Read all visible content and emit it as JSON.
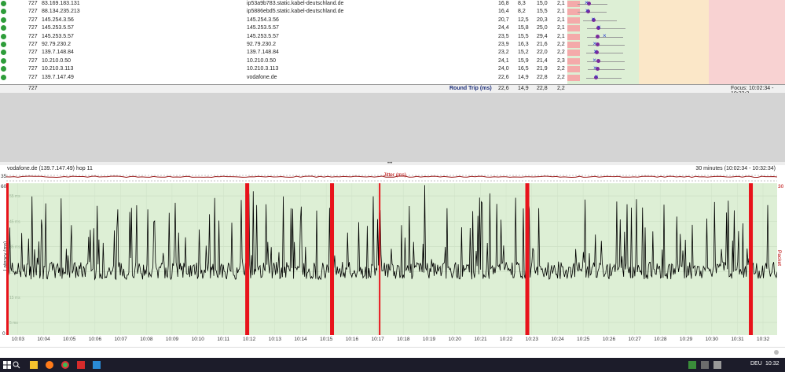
{
  "hops": [
    {
      "count": "727",
      "ip": "83.169.183.131",
      "name": "ip53a9b783.static.kabel-deutschland.de",
      "avg": "16,8",
      "min": "8,3",
      "cur": "15,0",
      "pl": "2,1"
    },
    {
      "count": "727",
      "ip": "88.134.235.213",
      "name": "ip5886ebd5.static.kabel-deutschland.de",
      "avg": "16,4",
      "min": "8,2",
      "cur": "15,5",
      "pl": "2,1"
    },
    {
      "count": "727",
      "ip": "145.254.3.56",
      "name": "145.254.3.56",
      "avg": "20,7",
      "min": "12,5",
      "cur": "20,3",
      "pl": "2,1"
    },
    {
      "count": "727",
      "ip": "145.253.5.57",
      "name": "145.253.5.57",
      "avg": "24,4",
      "min": "15,8",
      "cur": "25,0",
      "pl": "2,1"
    },
    {
      "count": "727",
      "ip": "145.253.5.57",
      "name": "145.253.5.57",
      "avg": "23,5",
      "min": "15,5",
      "cur": "29,4",
      "pl": "2,1"
    },
    {
      "count": "727",
      "ip": "92.79.230.2",
      "name": "92.79.230.2",
      "avg": "23,9",
      "min": "16,3",
      "cur": "21,6",
      "pl": "2,2"
    },
    {
      "count": "727",
      "ip": "139.7.148.84",
      "name": "139.7.148.84",
      "avg": "23,2",
      "min": "15,2",
      "cur": "22,0",
      "pl": "2,2"
    },
    {
      "count": "727",
      "ip": "10.210.0.50",
      "name": "10.210.0.50",
      "avg": "24,1",
      "min": "15,9",
      "cur": "21,4",
      "pl": "2,3"
    },
    {
      "count": "727",
      "ip": "10.210.3.113",
      "name": "10.210.3.113",
      "avg": "24,0",
      "min": "16,5",
      "cur": "21,9",
      "pl": "2,2"
    },
    {
      "count": "727",
      "ip": "139.7.147.49",
      "name": "vodafone.de",
      "avg": "22,6",
      "min": "14,9",
      "cur": "22,8",
      "pl": "2,2"
    }
  ],
  "footer": {
    "count": "727",
    "label": "Round Trip (ms)",
    "avg": "22,6",
    "min": "14,9",
    "cur": "22,8",
    "pl": "2,2",
    "focus": "Focus: 10:02:34 - 10:32:3"
  },
  "graph": {
    "title": "vodafone.de (139.7.147.49) hop 11",
    "range": "30 minutes (10:02:34 - 10:32:34)",
    "jitter_label": "Jitter (ms)",
    "y_left_title": "Latency (ms)",
    "y_right_title": "Packet Loss %",
    "y_left_top": "60",
    "y_left_jitter": "35",
    "y_left_zero": "0",
    "y_right_top": "30",
    "ms_ticks": [
      "55 ms",
      "45 ms",
      "35 ms",
      "25 ms",
      "15 ms",
      "5 ms"
    ],
    "x_ticks": [
      "10:03",
      "10:04",
      "10:05",
      "10:06",
      "10:07",
      "10:08",
      "10:09",
      "10:10",
      "10:11",
      "10:12",
      "10:13",
      "10:14",
      "10:15",
      "10:16",
      "10:17",
      "10:18",
      "10:19",
      "10:20",
      "10:21",
      "10:22",
      "10:23",
      "10:24",
      "10:25",
      "10:26",
      "10:27",
      "10:28",
      "10:29",
      "10:30",
      "10:31",
      "10:32"
    ],
    "loss_minutes": [
      9.3,
      12.6,
      14.5,
      20.2,
      28.9
    ],
    "colors": {
      "plot_bg": "#ddefd5",
      "loss": "#e8131b",
      "line": "#000000",
      "jitter": "#9a1c1c"
    }
  },
  "taskbar": {
    "lang": "DEU",
    "time": "10:32",
    "icons": [
      "start-icon",
      "search-icon",
      "explorer-icon",
      "firefox-icon",
      "chrome-icon",
      "app-red-icon",
      "app-blue-icon"
    ]
  }
}
